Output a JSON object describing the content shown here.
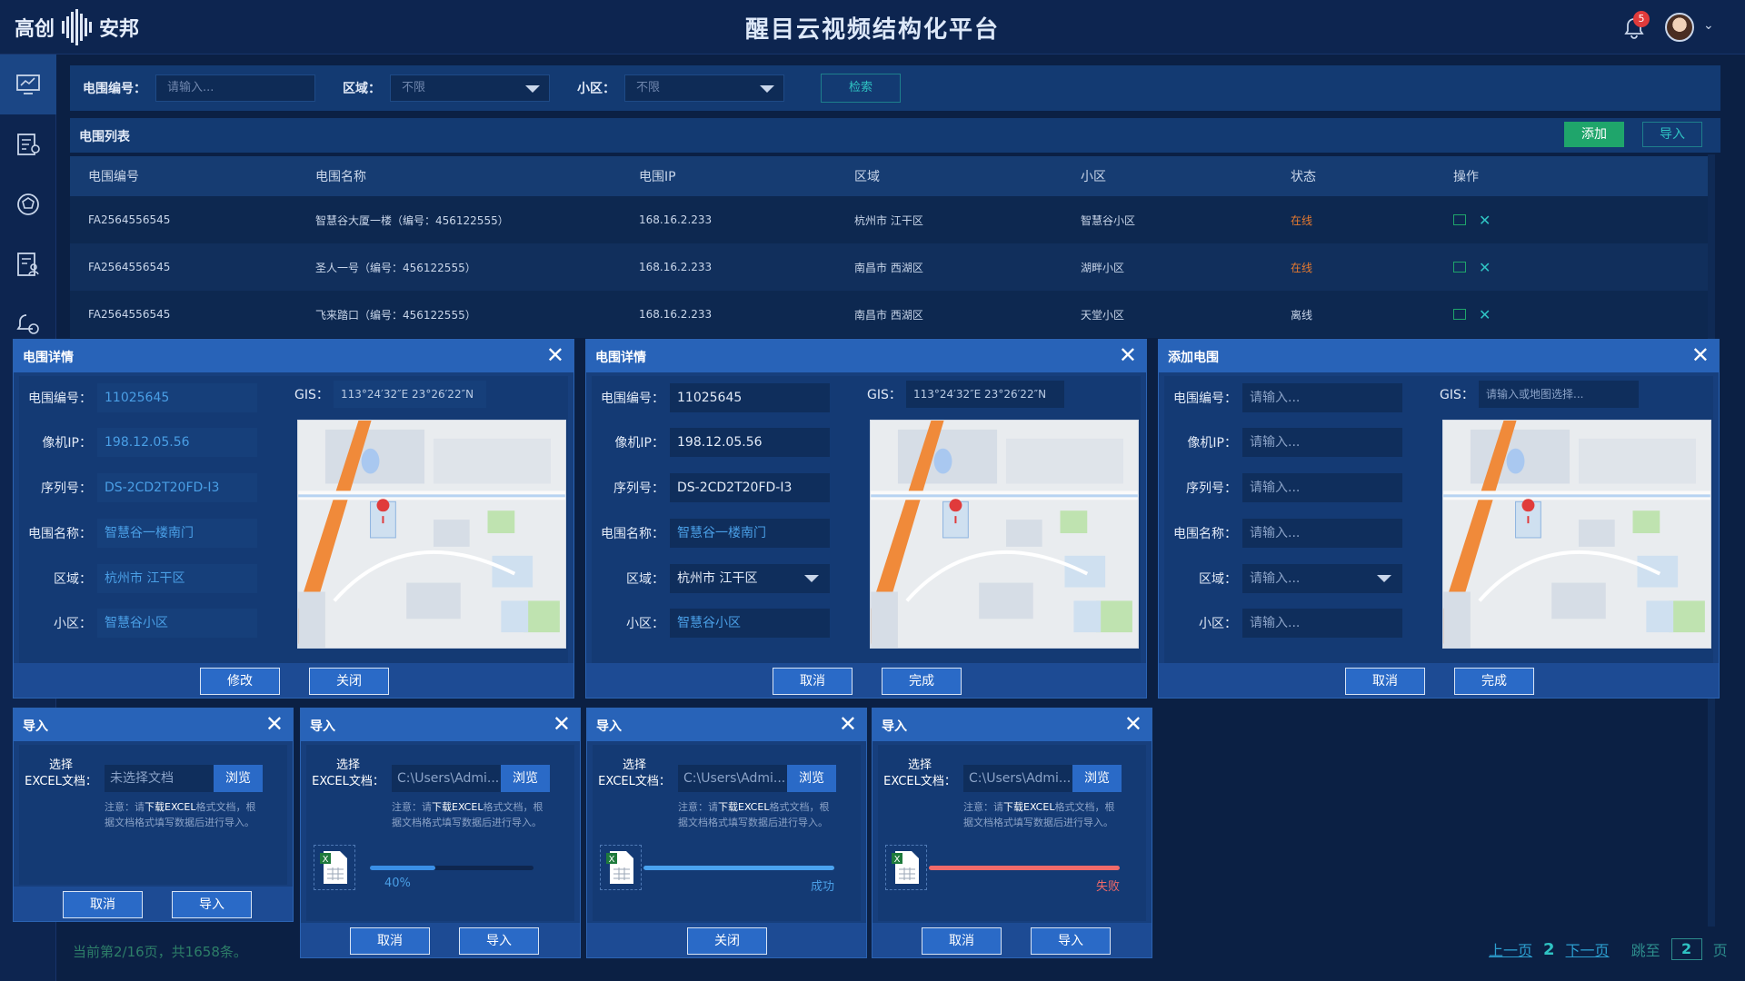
{
  "header": {
    "logo_text_1": "高创",
    "logo_text_2": "安邦",
    "title": "醒目云视频结构化平台",
    "notification_count": "5"
  },
  "sidebar": {
    "items": [
      {
        "icon": "monitor-icon",
        "active": true
      },
      {
        "icon": "list-settings-icon",
        "active": false
      },
      {
        "icon": "target-icon",
        "active": false
      },
      {
        "icon": "document-user-icon",
        "active": false
      },
      {
        "icon": "bell-settings-icon",
        "active": false
      }
    ]
  },
  "filter": {
    "fence_id_label": "电围编号：",
    "fence_id_placeholder": "请输入...",
    "region_label": "区域：",
    "region_value": "不限",
    "community_label": "小区：",
    "community_value": "不限",
    "search_label": "检索"
  },
  "list": {
    "title": "电围列表",
    "add_label": "添加",
    "import_label": "导入",
    "columns": [
      "电围编号",
      "电围名称",
      "电围IP",
      "区域",
      "小区",
      "状态",
      "操作"
    ],
    "rows": [
      {
        "id": "FA2564556545",
        "name": "智慧谷大厦一楼（编号：456122555）",
        "ip": "168.16.2.233",
        "region": "杭州市 江干区",
        "community": "智慧谷小区",
        "status": "在线"
      },
      {
        "id": "FA2564556545",
        "name": "圣人一号（编号：456122555）",
        "ip": "168.16.2.233",
        "region": "南昌市 西湖区",
        "community": "湖畔小区",
        "status": "在线"
      },
      {
        "id": "FA2564556545",
        "name": "飞来踏口（编号：456122555）",
        "ip": "168.16.2.233",
        "region": "南昌市 西湖区",
        "community": "天堂小区",
        "status": "离线"
      }
    ]
  },
  "footer": {
    "summary": "当前第2/16页，共1658条。",
    "prev": "上一页",
    "current": "2",
    "next": "下一页",
    "jump_label": "跳至",
    "jump_value": "2",
    "page_unit": "页"
  },
  "labels": {
    "fence_id": "电围编号：",
    "camera_ip": "像机IP：",
    "serial": "序列号：",
    "fence_name": "电围名称：",
    "region": "区域：",
    "community": "小区：",
    "gis": "GIS："
  },
  "detail_view": {
    "title": "电围详情",
    "fence_id": "11025645",
    "camera_ip": "198.12.05.56",
    "serial": "DS-2CD2T20FD-I3",
    "fence_name": "智慧谷一楼南门",
    "region": "杭州市 江干区",
    "community": "智慧谷小区",
    "gis": "113°24′32″E   23°26′22″N",
    "btn_edit": "修改",
    "btn_close": "关闭"
  },
  "detail_edit": {
    "title": "电围详情",
    "fence_id": "11025645",
    "camera_ip": "198.12.05.56",
    "serial": "DS-2CD2T20FD-I3",
    "fence_name": "智慧谷一楼南门",
    "region": "杭州市 江干区",
    "community": "智慧谷小区",
    "gis": "113°24′32″E   23°26′22″N",
    "btn_cancel": "取消",
    "btn_done": "完成"
  },
  "add_fence": {
    "title": "添加电围",
    "placeholder": "请输入...",
    "gis_placeholder": "请输入或地图选择...",
    "btn_cancel": "取消",
    "btn_done": "完成"
  },
  "import_dialogs": [
    {
      "title": "导入",
      "file": "未选择文档",
      "progress": null,
      "status": "",
      "btn_left": "取消",
      "btn_right": "导入",
      "color": "#2a6ac7"
    },
    {
      "title": "导入",
      "file": "C:\\Users\\Admi...",
      "progress": 0.4,
      "status": "40%",
      "btn_left": "取消",
      "btn_right": "导入",
      "color": "#3a8fe6"
    },
    {
      "title": "导入",
      "file": "C:\\Users\\Admi...",
      "progress": 1.0,
      "status": "成功",
      "btn_left": "关闭",
      "btn_right": "",
      "color": "#4aa3f0"
    },
    {
      "title": "导入",
      "file": "C:\\Users\\Admi...",
      "progress": 1.0,
      "status": "失败",
      "btn_left": "取消",
      "btn_right": "导入",
      "color": "#f06a6a"
    }
  ],
  "import_common": {
    "select_label_1": "选择",
    "select_label_2": "EXCEL文档：",
    "browse": "浏览",
    "note_1": "注意：请",
    "note_bold": "下载EXCEL",
    "note_2": "格式文档，根",
    "note_3": "据文档格式填写数据后进行导入。"
  },
  "colors": {
    "online": "#e87a2e",
    "accent": "#2fc3c3",
    "add_button": "#1fa56b",
    "dialog_header": "#2863b8"
  }
}
